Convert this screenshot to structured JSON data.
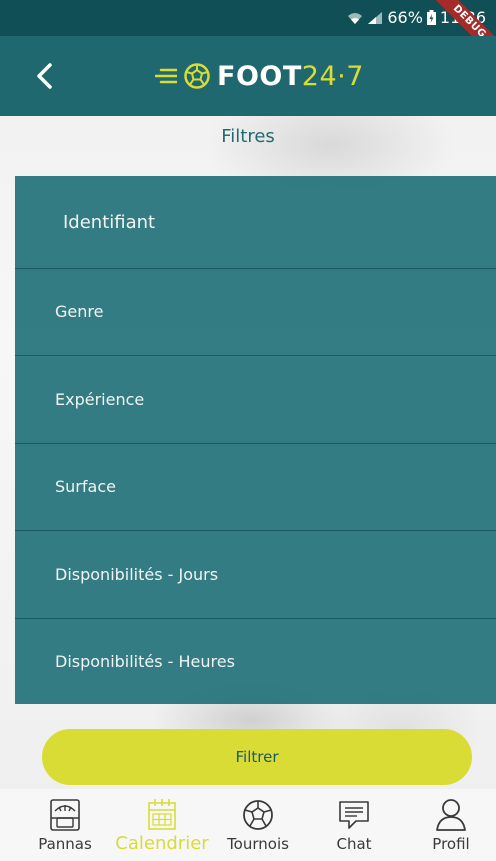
{
  "status_bar": {
    "battery": "66%",
    "time": "11:36",
    "ribbon": "DEBUG"
  },
  "app_bar": {
    "logo_word": "FOOT",
    "logo_number": "24·7"
  },
  "page": {
    "title": "Filtres"
  },
  "filters": [
    {
      "label": "Identifiant"
    },
    {
      "label": "Genre"
    },
    {
      "label": "Expérience"
    },
    {
      "label": "Surface"
    },
    {
      "label": "Disponibilités - Jours"
    },
    {
      "label": "Disponibilités - Heures"
    }
  ],
  "actions": {
    "filter_button": "Filtrer"
  },
  "bottom_nav": {
    "items": [
      {
        "label": "Pannas",
        "icon": "panna-cage-icon"
      },
      {
        "label": "Calendrier",
        "icon": "calendar-icon",
        "active": true
      },
      {
        "label": "Tournois",
        "icon": "soccer-ball-icon"
      },
      {
        "label": "Chat",
        "icon": "chat-icon"
      },
      {
        "label": "Profil",
        "icon": "person-icon"
      }
    ]
  },
  "colors": {
    "primary": "#1f6870",
    "status_bar": "#0f4f55",
    "accent": "#d9dc35"
  }
}
